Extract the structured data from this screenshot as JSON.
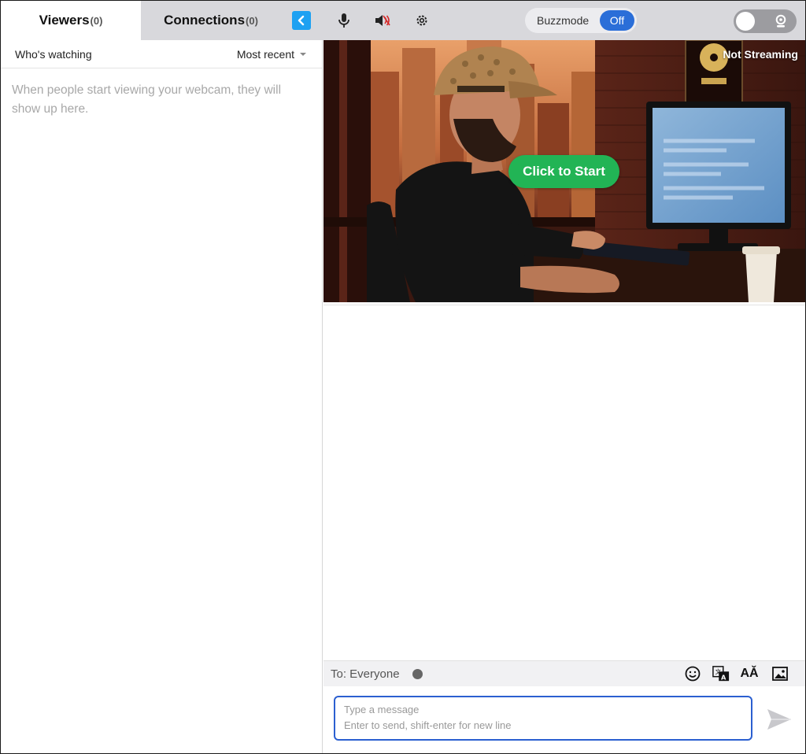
{
  "tabs": [
    {
      "label": "Viewers",
      "count": "(0)"
    },
    {
      "label": "Connections",
      "count": "(0)"
    }
  ],
  "controls": {
    "collapse_icon": "chevron-left-icon",
    "mic_icon": "microphone-icon",
    "speaker_icon": "speaker-muted-icon",
    "settings_icon": "gear-icon"
  },
  "buzzmode": {
    "label": "Buzzmode",
    "state": "Off"
  },
  "camera_toggle": {
    "icon": "webcam-icon",
    "on": false
  },
  "viewers_panel": {
    "header_label": "Who's watching",
    "sort": "Most recent",
    "empty_message": "When people start viewing your webcam, they will show up here."
  },
  "video": {
    "status": "Not Streaming",
    "start_label": "Click to Start"
  },
  "chat": {
    "to_label": "To: Everyone",
    "tools": [
      "emoji-icon",
      "translate-icon",
      "font-size-icon",
      "image-icon"
    ],
    "placeholder_line1": "Type a message",
    "placeholder_line2": "Enter to send, shift-enter for new line"
  },
  "colors": {
    "accent_blue": "#2a6ed8",
    "start_green": "#22b455",
    "collapse_blue": "#1ea1f2",
    "muted_red": "#d62828"
  }
}
